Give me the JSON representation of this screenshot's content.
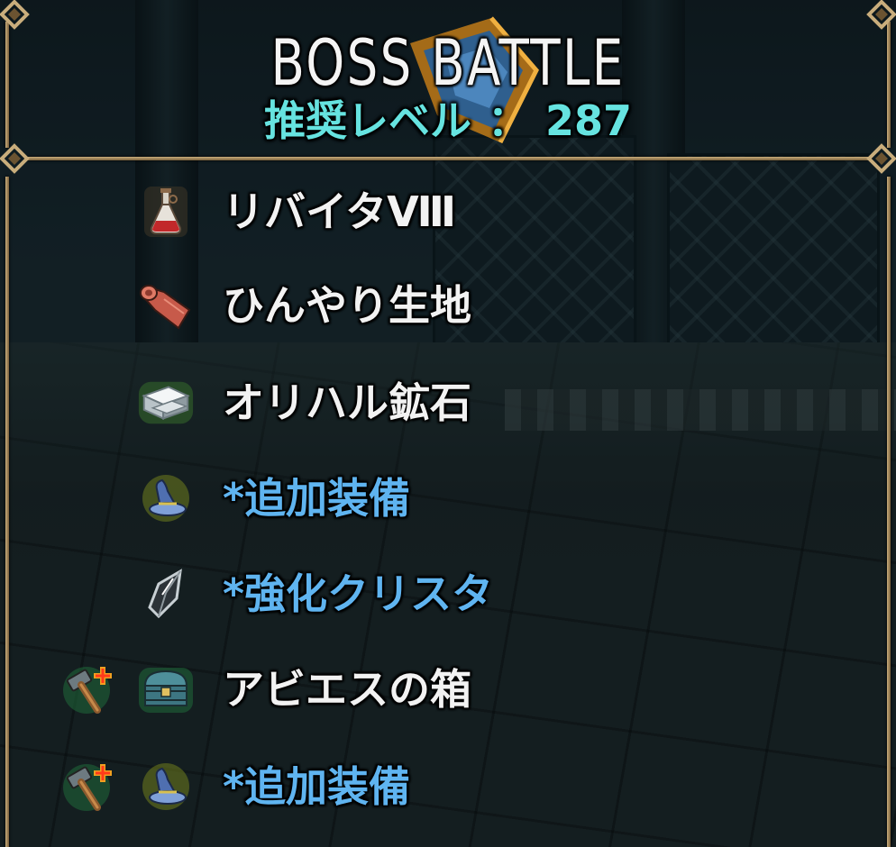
{
  "header": {
    "title": "BOSS BATTLE",
    "recommended_level_label": "推奨レベル",
    "separator": "：",
    "recommended_level_value": "287"
  },
  "drops": [
    {
      "name": "リバイタⅧ",
      "special": false,
      "icon": "potion-flask-icon",
      "has_bonus_hammer": false
    },
    {
      "name": "ひんやり生地",
      "special": false,
      "icon": "cloth-scroll-icon",
      "has_bonus_hammer": false
    },
    {
      "name": "オリハル鉱石",
      "special": false,
      "icon": "ore-ingot-icon",
      "has_bonus_hammer": false
    },
    {
      "name": "*追加装備",
      "special": true,
      "icon": "wizard-hat-icon",
      "has_bonus_hammer": false
    },
    {
      "name": "*強化クリスタ",
      "special": true,
      "icon": "crystal-shard-icon",
      "has_bonus_hammer": false
    },
    {
      "name": "アビエスの箱",
      "special": false,
      "icon": "treasure-chest-icon",
      "has_bonus_hammer": true
    },
    {
      "name": "*追加装備",
      "special": true,
      "icon": "wizard-hat-icon",
      "has_bonus_hammer": true
    }
  ],
  "colors": {
    "normal_item_text": "#f2f2f2",
    "special_item_text": "#5fb4f0",
    "recommended_level_text": "#66e3e0",
    "frame_gold": "#c9ad7c"
  }
}
